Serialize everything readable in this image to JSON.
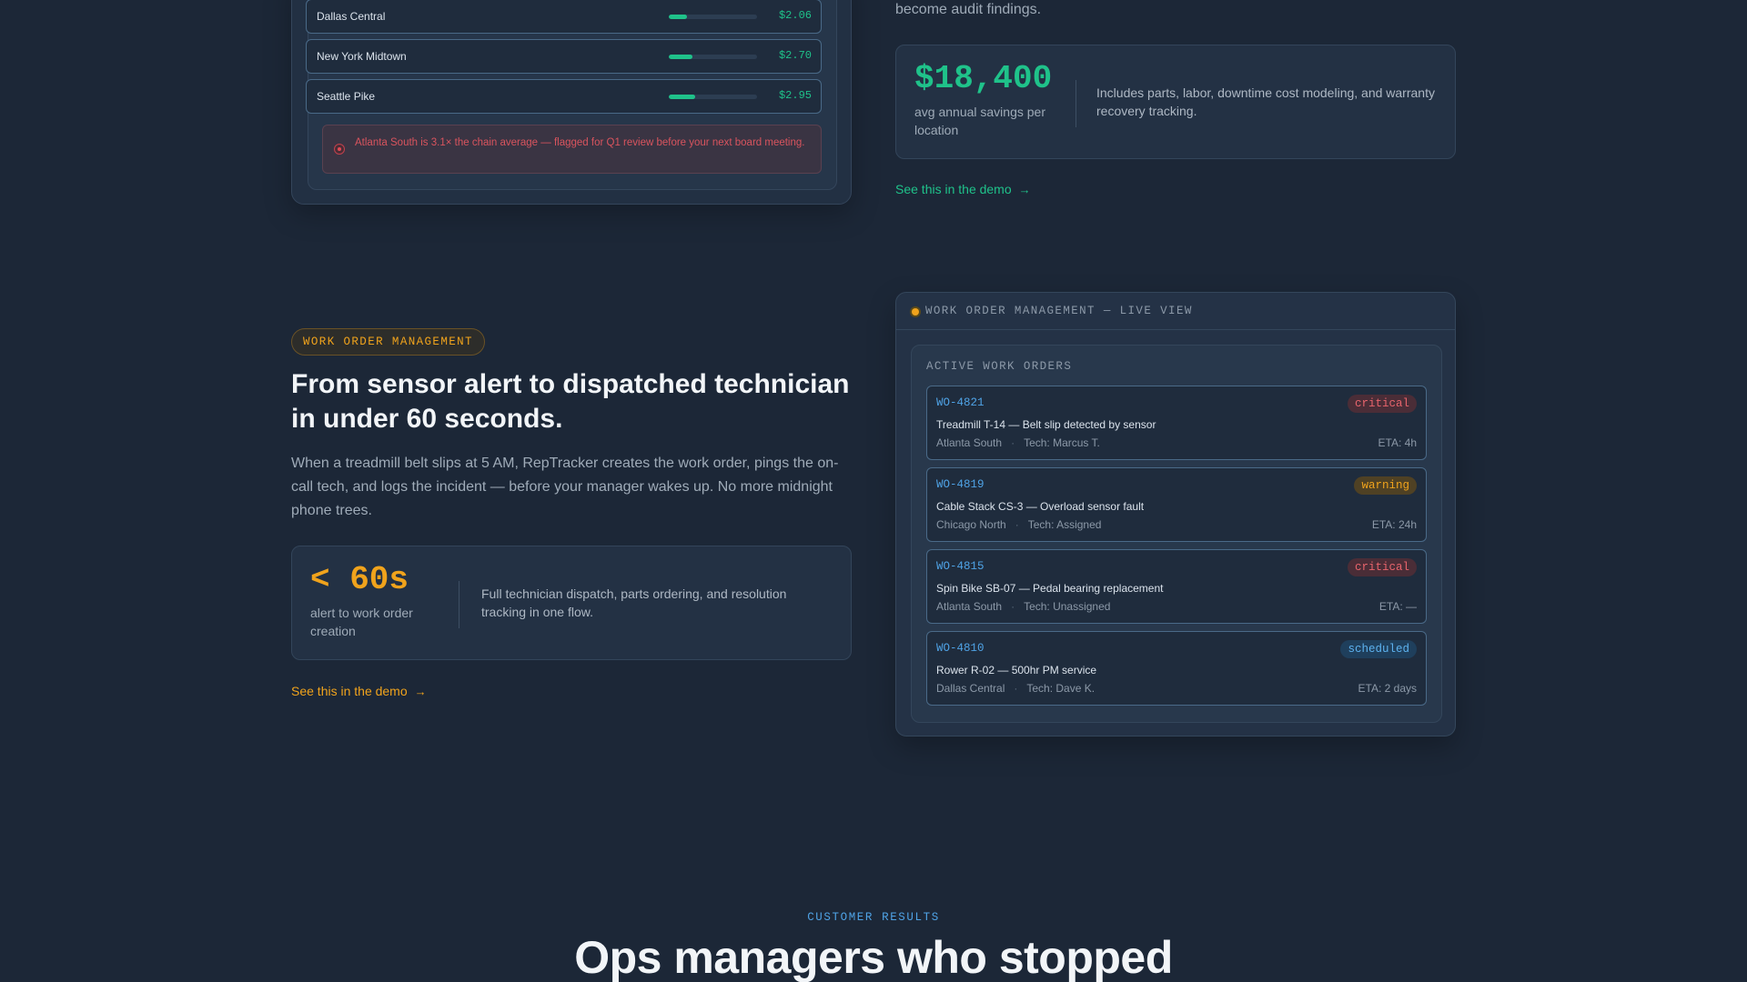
{
  "cost_panel": {
    "rows": [
      {
        "name": "Dallas Central",
        "price": "$2.06",
        "level": 0.21
      },
      {
        "name": "New York Midtown",
        "price": "$2.70",
        "level": 0.27
      },
      {
        "name": "Seattle Pike",
        "price": "$2.95",
        "level": 0.3
      }
    ],
    "alert": "Atlanta South is 3.1× the chain average — flagged for Q1 review before your next board meeting."
  },
  "savings_section": {
    "trailing_text": "become audit findings.",
    "stat_value": "$18,400",
    "stat_label": "avg annual savings per location",
    "stat_desc": "Includes parts, labor, downtime cost modeling, and warranty recovery tracking.",
    "demo_link": "See this in the demo",
    "accent": "#1fc28a"
  },
  "work_orders_section": {
    "pill": "WORK ORDER MANAGEMENT",
    "headline": "From sensor alert to dispatched technician in under 60 seconds.",
    "paragraph": "When a treadmill belt slips at 5 AM, RepTracker creates the work order, pings the on-call tech, and logs the incident — before your manager wakes up. No more midnight phone trees.",
    "stat_value": "< 60s",
    "stat_label": "alert to work order creation",
    "stat_desc": "Full technician dispatch, parts ordering, and resolution tracking in one flow.",
    "demo_link": "See this in the demo",
    "accent": "#f0a31c"
  },
  "live_view": {
    "title": "WORK ORDER MANAGEMENT — LIVE VIEW",
    "box_title": "ACTIVE WORK ORDERS",
    "orders": [
      {
        "id": "WO-4821",
        "status": "critical",
        "desc": "Treadmill T-14 — Belt slip detected by sensor",
        "location": "Atlanta South",
        "tech": "Tech: Marcus T.",
        "eta": "ETA: 4h"
      },
      {
        "id": "WO-4819",
        "status": "warning",
        "desc": "Cable Stack CS-3 — Overload sensor fault",
        "location": "Chicago North",
        "tech": "Tech: Assigned",
        "eta": "ETA: 24h"
      },
      {
        "id": "WO-4815",
        "status": "critical",
        "desc": "Spin Bike SB-07 — Pedal bearing replacement",
        "location": "Atlanta South",
        "tech": "Tech: Unassigned",
        "eta": "ETA: —"
      },
      {
        "id": "WO-4810",
        "status": "scheduled",
        "desc": "Rower R-02 — 500hr PM service",
        "location": "Dallas Central",
        "tech": "Tech: Dave K.",
        "eta": "ETA: 2 days"
      }
    ],
    "separator": "·"
  },
  "customer_results": {
    "label": "CUSTOMER RESULTS",
    "headline": "Ops managers who stopped"
  },
  "icons": {
    "link_arrow": "arrow-right-icon",
    "alert": "alert-dot-icon",
    "live": "live-status-dot-icon"
  }
}
